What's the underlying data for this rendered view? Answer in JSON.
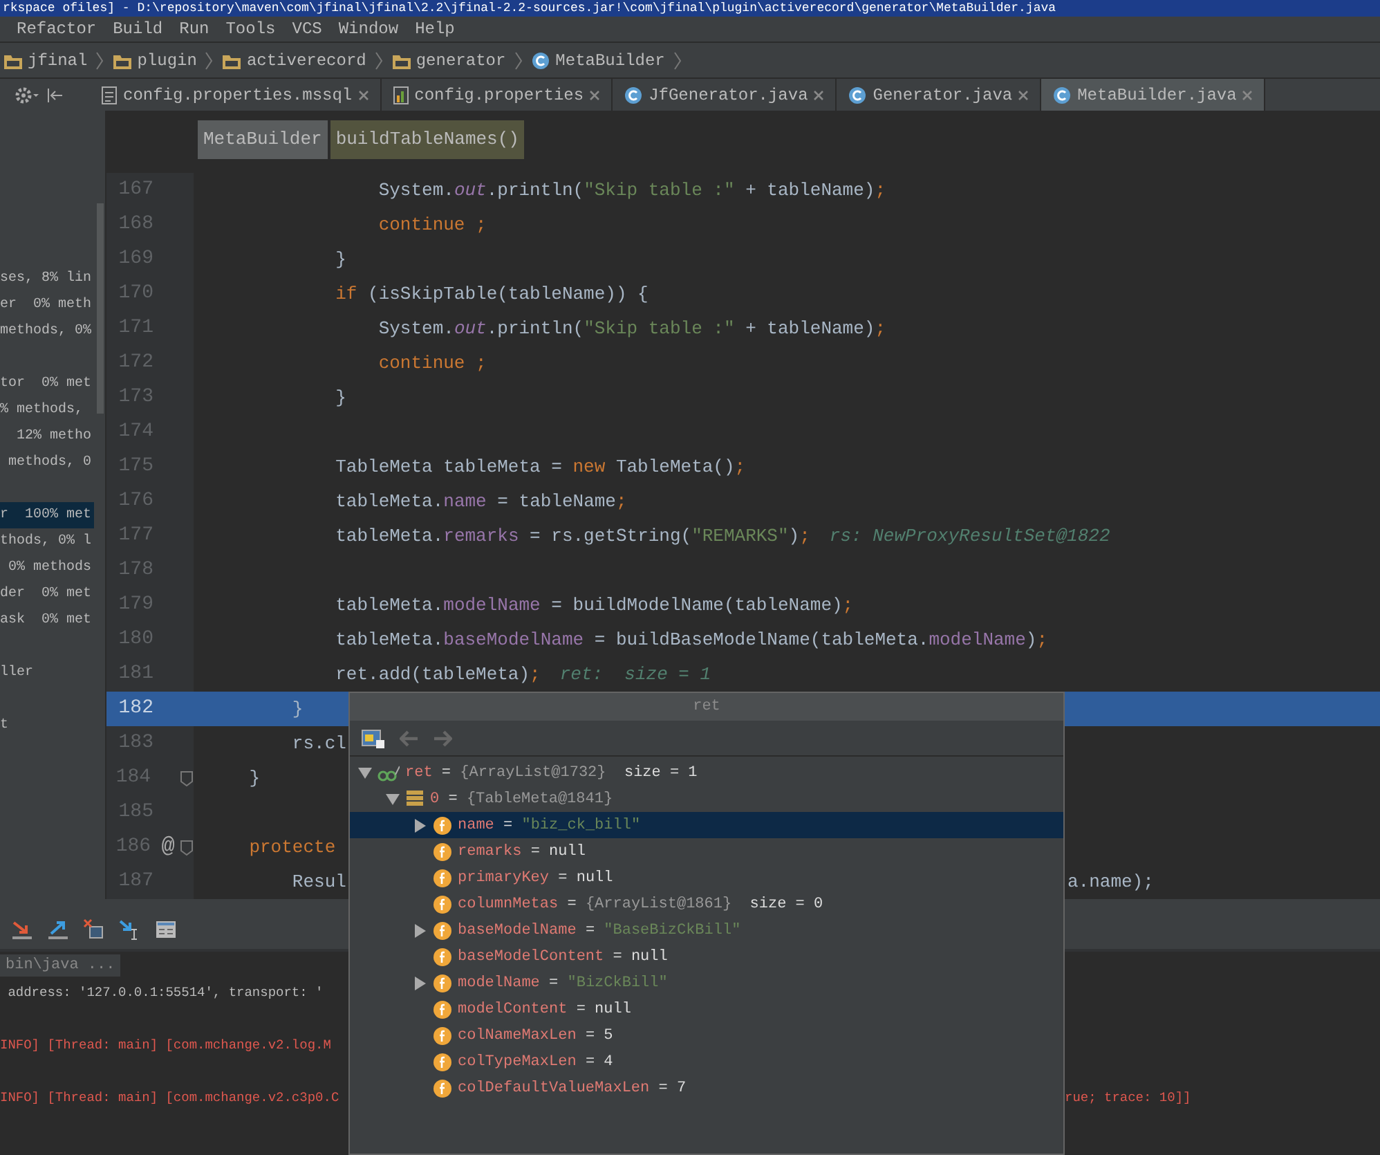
{
  "window": {
    "title": "rkspace ofiles] - D:\\repository\\maven\\com\\jfinal\\jfinal\\2.2\\jfinal-2.2-sources.jar!\\com\\jfinal\\plugin\\activerecord\\generator\\MetaBuilder.java"
  },
  "menu": {
    "items": [
      "Refactor",
      "Build",
      "Run",
      "Tools",
      "VCS",
      "Window",
      "Help"
    ]
  },
  "breadcrumb": [
    {
      "label": "jfinal",
      "kind": "folder"
    },
    {
      "label": "plugin",
      "kind": "folder"
    },
    {
      "label": "activerecord",
      "kind": "folder"
    },
    {
      "label": "generator",
      "kind": "folder"
    },
    {
      "label": "MetaBuilder",
      "kind": "class"
    }
  ],
  "tabs": [
    {
      "label": "config.properties.mssql",
      "kind": "file",
      "selected": false
    },
    {
      "label": "config.properties",
      "kind": "properties",
      "selected": false
    },
    {
      "label": "JfGenerator.java",
      "kind": "class",
      "selected": false
    },
    {
      "label": "Generator.java",
      "kind": "class",
      "selected": false
    },
    {
      "label": "MetaBuilder.java",
      "kind": "class",
      "selected": true
    }
  ],
  "coverage_panel": {
    "groups": [
      [
        {
          "label": "ses, 8% lin",
          "selected": false
        },
        {
          "label": "er  0% meth",
          "selected": false
        },
        {
          "label": "methods, 0%",
          "selected": false
        }
      ],
      [
        {
          "label": "tor  0% met",
          "selected": false
        },
        {
          "label": "% methods,",
          "selected": false
        },
        {
          "label": "  12% metho",
          "selected": false
        },
        {
          "label": " methods, 0",
          "selected": false
        }
      ],
      [
        {
          "label": "r  100% met",
          "selected": true
        },
        {
          "label": "thods, 0% l",
          "selected": false
        },
        {
          "label": " 0% methods",
          "selected": false
        },
        {
          "label": "der  0% met",
          "selected": false
        },
        {
          "label": "ask  0% met",
          "selected": false
        }
      ],
      [
        {
          "label": "ller",
          "selected": false
        }
      ],
      [
        {
          "label": "t",
          "selected": false
        }
      ]
    ]
  },
  "editor": {
    "crumbs": [
      {
        "label": "MetaBuilder",
        "selected": false
      },
      {
        "label": "buildTableNames()",
        "selected": true
      }
    ],
    "lines": [
      {
        "number": "167",
        "tokens": [
          {
            "text": "                System.",
            "kind": "plain"
          },
          {
            "text": "out",
            "kind": "static"
          },
          {
            "text": ".println(",
            "kind": "plain"
          },
          {
            "text": "\"Skip table :\"",
            "kind": "string"
          },
          {
            "text": " + tableName)",
            "kind": "plain"
          },
          {
            "text": ";",
            "kind": "keyword"
          }
        ]
      },
      {
        "number": "168",
        "tokens": [
          {
            "text": "                continue ;",
            "kind": "keyword"
          }
        ]
      },
      {
        "number": "169",
        "tokens": [
          {
            "text": "            }",
            "kind": "plain"
          }
        ]
      },
      {
        "number": "170",
        "tokens": [
          {
            "text": "            if",
            "kind": "keyword"
          },
          {
            "text": " (isSkipTable(tableName)) {",
            "kind": "plain"
          }
        ]
      },
      {
        "number": "171",
        "tokens": [
          {
            "text": "                System.",
            "kind": "plain"
          },
          {
            "text": "out",
            "kind": "static"
          },
          {
            "text": ".println(",
            "kind": "plain"
          },
          {
            "text": "\"Skip table :\"",
            "kind": "string"
          },
          {
            "text": " + tableName)",
            "kind": "plain"
          },
          {
            "text": ";",
            "kind": "keyword"
          }
        ]
      },
      {
        "number": "172",
        "tokens": [
          {
            "text": "                continue ;",
            "kind": "keyword"
          }
        ]
      },
      {
        "number": "173",
        "tokens": [
          {
            "text": "            }",
            "kind": "plain"
          }
        ]
      },
      {
        "number": "174"
      },
      {
        "number": "175",
        "tokens": [
          {
            "text": "            TableMeta tableMeta = ",
            "kind": "plain"
          },
          {
            "text": "new",
            "kind": "keyword"
          },
          {
            "text": " TableMeta()",
            "kind": "plain"
          },
          {
            "text": ";",
            "kind": "keyword"
          }
        ]
      },
      {
        "number": "176",
        "tokens": [
          {
            "text": "            tableMeta.",
            "kind": "plain"
          },
          {
            "text": "name",
            "kind": "field"
          },
          {
            "text": " = tableName",
            "kind": "plain"
          },
          {
            "text": ";",
            "kind": "keyword"
          }
        ]
      },
      {
        "number": "177",
        "tokens": [
          {
            "text": "            tableMeta.",
            "kind": "plain"
          },
          {
            "text": "remarks",
            "kind": "field"
          },
          {
            "text": " = rs.getString(",
            "kind": "plain"
          },
          {
            "text": "\"REMARKS\"",
            "kind": "string"
          },
          {
            "text": ")",
            "kind": "plain"
          },
          {
            "text": ";",
            "kind": "keyword"
          }
        ],
        "hint": "rs: NewProxyResultSet@1822"
      },
      {
        "number": "178"
      },
      {
        "number": "179",
        "tokens": [
          {
            "text": "            tableMeta.",
            "kind": "plain"
          },
          {
            "text": "modelName",
            "kind": "field"
          },
          {
            "text": " = buildModelName(tableName)",
            "kind": "plain"
          },
          {
            "text": ";",
            "kind": "keyword"
          }
        ]
      },
      {
        "number": "180",
        "tokens": [
          {
            "text": "            tableMeta.",
            "kind": "plain"
          },
          {
            "text": "baseModelName",
            "kind": "field"
          },
          {
            "text": " = buildBaseModelName(tableMeta.",
            "kind": "plain"
          },
          {
            "text": "modelName",
            "kind": "field"
          },
          {
            "text": ")",
            "kind": "plain"
          },
          {
            "text": ";",
            "kind": "keyword"
          }
        ]
      },
      {
        "number": "181",
        "tokens": [
          {
            "text": "            ret.add(tableMeta)",
            "kind": "plain"
          },
          {
            "text": ";",
            "kind": "keyword"
          }
        ],
        "hint": "ret:  size = 1"
      },
      {
        "number": "182",
        "current": true,
        "tokens": [
          {
            "text": "        }",
            "kind": "plain"
          }
        ]
      },
      {
        "number": "183",
        "tokens": [
          {
            "text": "        rs.cl",
            "kind": "plain"
          }
        ]
      },
      {
        "number": "184",
        "fold": true,
        "tokens": [
          {
            "text": "    }",
            "kind": "plain"
          }
        ]
      },
      {
        "number": "185"
      },
      {
        "number": "186",
        "fold": true,
        "mark": "@",
        "tokens": [
          {
            "text": "    protecte",
            "kind": "keyword"
          }
        ]
      },
      {
        "number": "187",
        "tokens": [
          {
            "text": "        Resul",
            "kind": "plain"
          }
        ],
        "tail": "a.name);"
      }
    ]
  },
  "debug_toolbar": {
    "icons": [
      {
        "kind": "down-arrow"
      },
      {
        "kind": "up-arrow"
      },
      {
        "kind": "window-cross"
      },
      {
        "kind": "cursor-arrow"
      },
      {
        "kind": "table"
      }
    ]
  },
  "console": {
    "header": "bin\\java ...",
    "lines": [
      {
        "kind": "info",
        "text": " address: '127.0.0.1:55514', transport: '"
      },
      {
        "kind": "error",
        "text": "INFO] [Thread: main] [com.mchange.v2.log.M"
      },
      {
        "kind": "error",
        "text": "INFO] [Thread: main] [com.mchange.v2.c3p0.C",
        "tail": "rue; trace: 10]]"
      }
    ]
  },
  "popup": {
    "title": "ret",
    "tree": [
      {
        "name": "ret",
        "op": "=",
        "value": {
          "text": "{ArrayList@1732}",
          "kind": "object"
        },
        "extra": "size = 1",
        "kind": "watch",
        "expanded": true,
        "selected": false,
        "children": [
          {
            "name": "0",
            "op": "=",
            "value": {
              "text": "{TableMeta@1841}",
              "kind": "object"
            },
            "kind": "element",
            "expanded": true,
            "selected": false,
            "children": [
              {
                "name": "name",
                "op": "=",
                "value": {
                  "text": "\"biz_ck_bill\"",
                  "kind": "string"
                },
                "kind": "field",
                "expanded": false,
                "selected": true
              },
              {
                "name": "remarks",
                "op": "=",
                "value": {
                  "text": "null",
                  "kind": "plain"
                },
                "kind": "field",
                "selected": false
              },
              {
                "name": "primaryKey",
                "op": "=",
                "value": {
                  "text": "null",
                  "kind": "plain"
                },
                "kind": "field",
                "selected": false
              },
              {
                "name": "columnMetas",
                "op": "=",
                "value": {
                  "text": "{ArrayList@1861}",
                  "kind": "object"
                },
                "extra": "size = 0",
                "kind": "field",
                "selected": false
              },
              {
                "name": "baseModelName",
                "op": "=",
                "value": {
                  "text": "\"BaseBizCkBill\"",
                  "kind": "string"
                },
                "kind": "field",
                "expanded": false,
                "selected": false
              },
              {
                "name": "baseModelContent",
                "op": "=",
                "value": {
                  "text": "null",
                  "kind": "plain"
                },
                "kind": "field",
                "selected": false
              },
              {
                "name": "modelName",
                "op": "=",
                "value": {
                  "text": "\"BizCkBill\"",
                  "kind": "string"
                },
                "kind": "field",
                "expanded": false,
                "selected": false
              },
              {
                "name": "modelContent",
                "op": "=",
                "value": {
                  "text": "null",
                  "kind": "plain"
                },
                "kind": "field",
                "selected": false
              },
              {
                "name": "colNameMaxLen",
                "op": "=",
                "value": {
                  "text": "5",
                  "kind": "plain"
                },
                "kind": "field",
                "selected": false
              },
              {
                "name": "colTypeMaxLen",
                "op": "=",
                "value": {
                  "text": "4",
                  "kind": "plain"
                },
                "kind": "field",
                "selected": false
              },
              {
                "name": "colDefaultValueMaxLen",
                "op": "=",
                "value": {
                  "text": "7",
                  "kind": "plain"
                },
                "kind": "field",
                "selected": false
              }
            ]
          }
        ]
      }
    ]
  }
}
